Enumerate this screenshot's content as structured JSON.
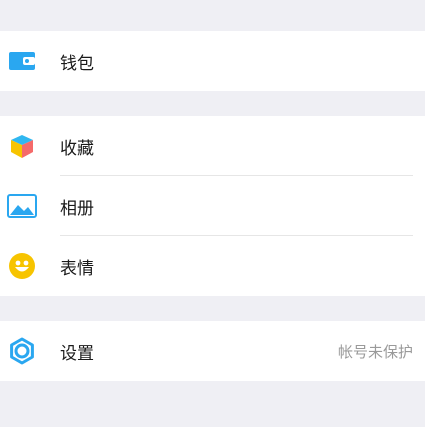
{
  "sections": [
    {
      "items": [
        {
          "label": "钱包",
          "icon": "wallet-icon",
          "color": "#2aa7f0"
        }
      ]
    },
    {
      "items": [
        {
          "label": "收藏",
          "icon": "favorites-cube-icon"
        },
        {
          "label": "相册",
          "icon": "album-image-icon",
          "color": "#2aa7f0"
        },
        {
          "label": "表情",
          "icon": "smiley-icon",
          "color": "#f7c400"
        }
      ]
    },
    {
      "items": [
        {
          "label": "设置",
          "status": "帐号未保护",
          "icon": "settings-gear-icon",
          "color": "#2aa7f0"
        }
      ]
    }
  ]
}
